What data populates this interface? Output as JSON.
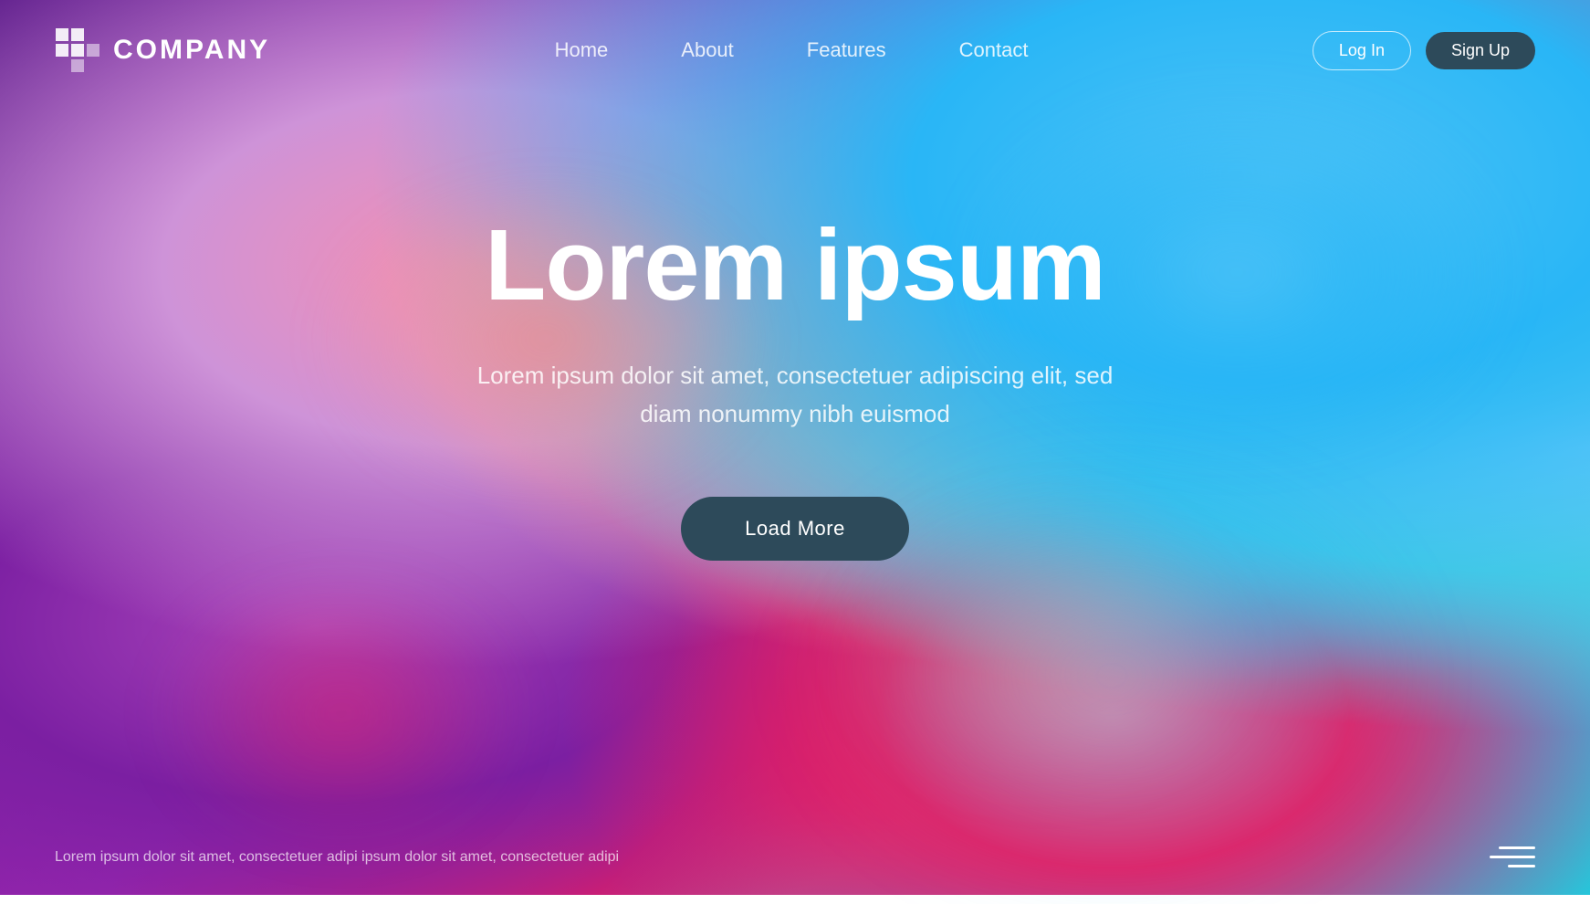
{
  "brand": {
    "name": "COMPANY"
  },
  "navbar": {
    "links": [
      {
        "label": "Home"
      },
      {
        "label": "About"
      },
      {
        "label": "Features"
      },
      {
        "label": "Contact"
      }
    ],
    "login_label": "Log In",
    "signup_label": "Sign Up"
  },
  "hero": {
    "title": "Lorem ipsum",
    "subtitle": "Lorem ipsum dolor sit amet, consectetuer adipiscing elit, sed diam nonummy nibh euismod",
    "cta_label": "Load More"
  },
  "footer": {
    "text": "Lorem ipsum dolor sit amet, consectetuer adipi ipsum dolor sit amet, consectetuer adipi",
    "hamburger_lines": [
      40,
      50,
      30
    ]
  },
  "colors": {
    "bg_dark": "#2d4a5a",
    "accent_blue": "#4fc3f7"
  }
}
